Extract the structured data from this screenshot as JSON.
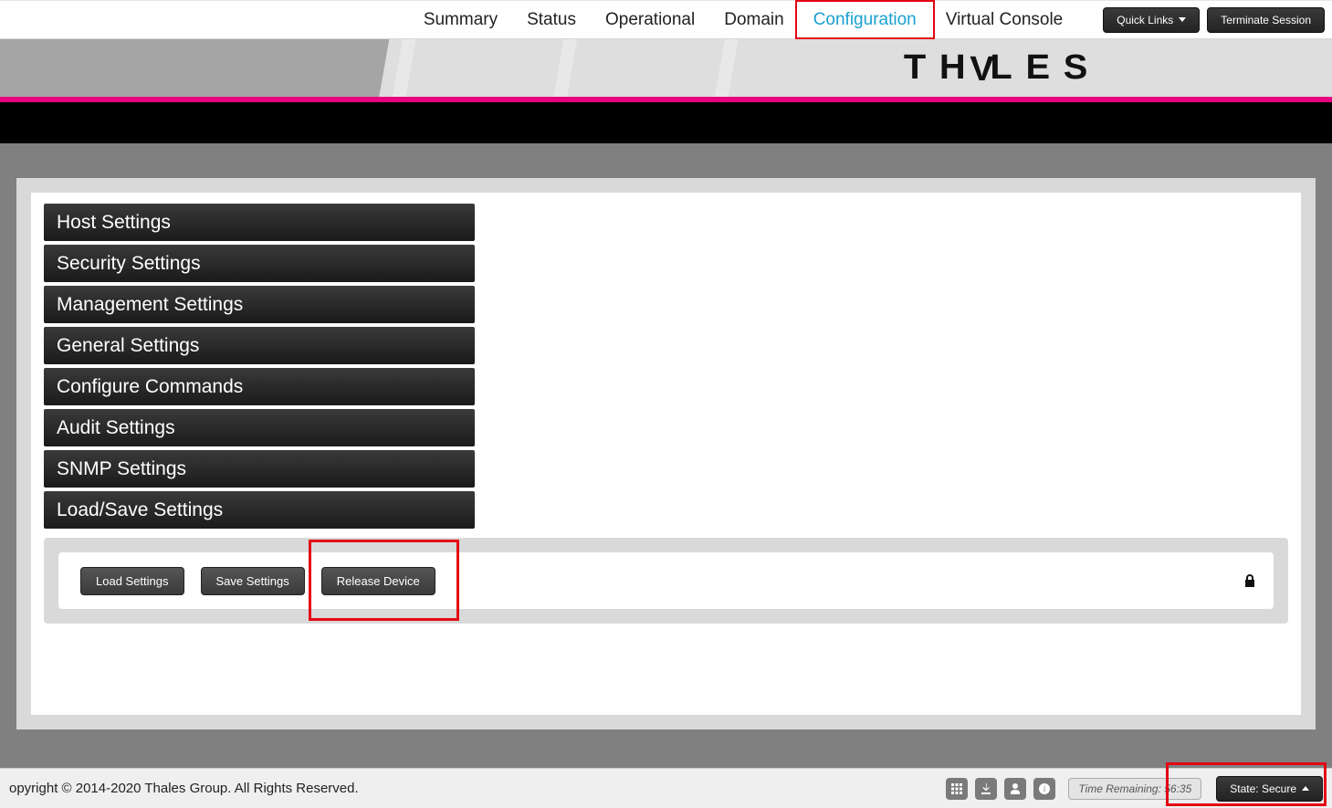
{
  "nav": {
    "tabs": [
      "Summary",
      "Status",
      "Operational",
      "Domain",
      "Configuration",
      "Virtual Console"
    ],
    "active_index": 4,
    "quick_links_label": "Quick Links",
    "terminate_label": "Terminate Session"
  },
  "brand": {
    "text": "THALES"
  },
  "accordion": {
    "items": [
      "Host Settings",
      "Security Settings",
      "Management Settings",
      "General Settings",
      "Configure Commands",
      "Audit Settings",
      "SNMP Settings",
      "Load/Save Settings"
    ]
  },
  "load_save_panel": {
    "load_label": "Load Settings",
    "save_label": "Save Settings",
    "release_label": "Release Device"
  },
  "footer": {
    "copyright": "opyright © 2014-2020 Thales Group. All Rights Reserved.",
    "time_remaining_label": "Time Remaining: 56:35",
    "state_label": "State: Secure"
  },
  "highlights": {
    "configuration_tab": true,
    "release_device": true,
    "state_secure": true
  }
}
